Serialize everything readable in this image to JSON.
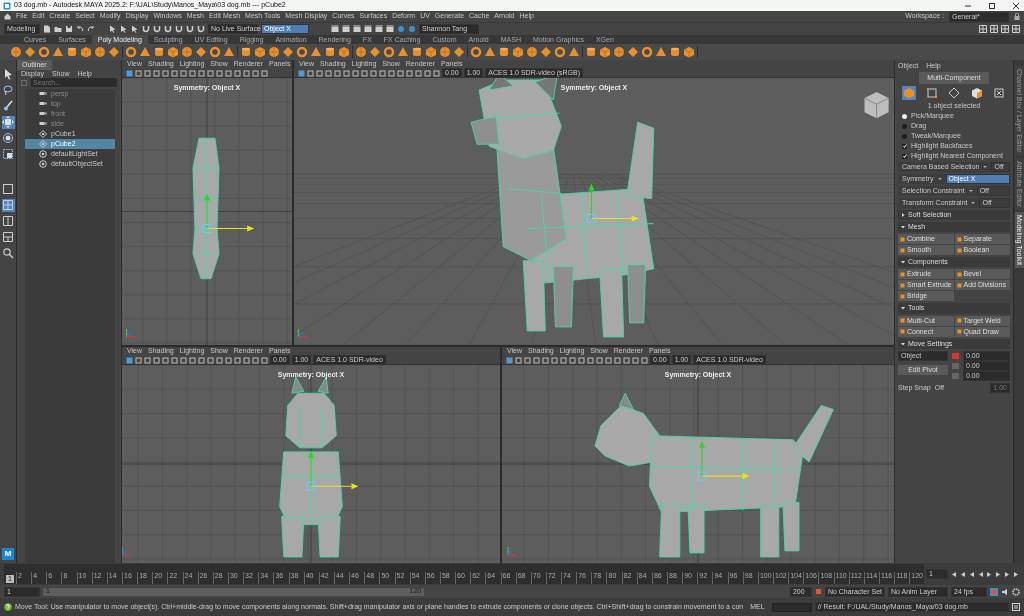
{
  "window": {
    "title": "03 dog.mb - Autodesk MAYA 2025.2: F:\\UAL\\Study\\Manos_Maya\\03 dog.mb  ---  pCube2"
  },
  "menu": [
    "File",
    "Edit",
    "Create",
    "Select",
    "Modify",
    "Display",
    "Windows",
    "Mesh",
    "Edit Mesh",
    "Mesh Tools",
    "Mesh Display",
    "Curves",
    "Surfaces",
    "Deform",
    "UV",
    "Generate",
    "Cache",
    "Arnold",
    "Help"
  ],
  "workspace": {
    "label": "Workspace :",
    "value": "General*"
  },
  "status_line": {
    "mode": "Modeling",
    "live_surface": "No Live Surface",
    "symmetry": "Object X",
    "user": "Shannon Tang"
  },
  "shelf_tabs": [
    {
      "label": "Curves",
      "selected": false
    },
    {
      "label": "Surfaces",
      "selected": false
    },
    {
      "label": "Poly Modeling",
      "selected": true
    },
    {
      "label": "Sculpting",
      "selected": false
    },
    {
      "label": "UV Editing",
      "selected": false
    },
    {
      "label": "Rigging",
      "selected": false
    },
    {
      "label": "Animation",
      "selected": false
    },
    {
      "label": "Rendering",
      "selected": false
    },
    {
      "label": "FX",
      "selected": false
    },
    {
      "label": "FX Caching",
      "selected": false
    },
    {
      "label": "Custom",
      "selected": false
    },
    {
      "label": "Arnold",
      "selected": false
    },
    {
      "label": "MASH",
      "selected": false
    },
    {
      "label": "Motion Graphics",
      "selected": false
    },
    {
      "label": "XGen",
      "selected": false
    }
  ],
  "outliner": {
    "title": "Outliner",
    "menu": [
      "Display",
      "Show",
      "Help"
    ],
    "search_placeholder": "Search...",
    "items": [
      {
        "label": "persp",
        "kind": "camera",
        "selected": false,
        "dimmed": true
      },
      {
        "label": "top",
        "kind": "camera",
        "selected": false,
        "dimmed": true
      },
      {
        "label": "front",
        "kind": "camera",
        "selected": false,
        "dimmed": true
      },
      {
        "label": "side",
        "kind": "camera",
        "selected": false,
        "dimmed": true
      },
      {
        "label": "pCube1",
        "kind": "mesh",
        "selected": false,
        "dimmed": false
      },
      {
        "label": "pCube2",
        "kind": "mesh",
        "selected": true,
        "dimmed": false
      },
      {
        "label": "defaultLightSet",
        "kind": "set",
        "selected": false,
        "dimmed": false
      },
      {
        "label": "defaultObjectSet",
        "kind": "set",
        "selected": false,
        "dimmed": false
      }
    ]
  },
  "viewports": [
    {
      "kind": "top",
      "menu": [
        "View",
        "Shading",
        "Lighting",
        "Show",
        "Renderer",
        "Panels"
      ],
      "symmetry": "Symmetry: Object X"
    },
    {
      "kind": "persp",
      "menu": [
        "View",
        "Shading",
        "Lighting",
        "Show",
        "Renderer",
        "Panels"
      ],
      "symmetry": "Symmetry: Object X",
      "exposure": "0.00",
      "gamma": "1.00",
      "color_space": "ACES 1.0 SDR-video (sRGB)"
    },
    {
      "kind": "front",
      "menu": [
        "View",
        "Shading",
        "Lighting",
        "Show",
        "Renderer",
        "Panels"
      ],
      "symmetry": "Symmetry: Object X",
      "exposure": "0.00",
      "gamma": "1.00",
      "color_space": "ACES 1.0 SDR-video"
    },
    {
      "kind": "side",
      "menu": [
        "View",
        "Shading",
        "Lighting",
        "Show",
        "Renderer",
        "Panels"
      ],
      "symmetry": "Symmetry: Object X",
      "exposure": "0.00",
      "gamma": "1.00",
      "color_space": "ACES 1.0 SDR-video"
    }
  ],
  "toolkit": {
    "menu": [
      "Object",
      "Help"
    ],
    "mode_button": "Multi-Component",
    "component_modes": [
      {
        "selected": true
      },
      {
        "selected": false
      },
      {
        "selected": false
      },
      {
        "selected": false
      },
      {
        "selected": false
      }
    ],
    "selection_info": "1 object selected",
    "pick_modes": [
      {
        "label": "Pick/Marquee",
        "selected": true
      },
      {
        "label": "Drag",
        "selected": false
      },
      {
        "label": "Tweak/Marquee",
        "selected": false
      }
    ],
    "options": [
      {
        "label": "Highlight Backfaces",
        "checked": true
      },
      {
        "label": "Highlight Nearest Component",
        "checked": true
      }
    ],
    "properties": [
      {
        "label": "Camera Based Selection",
        "value": "Off",
        "highlighted": false
      },
      {
        "label": "Symmetry",
        "value": "Object X",
        "highlighted": true
      },
      {
        "label": "Selection Constraint",
        "value": "Off",
        "highlighted": false
      },
      {
        "label": "Transform Constraint",
        "value": "Off",
        "highlighted": false
      }
    ],
    "sections": [
      {
        "title": "Soft Selection",
        "expanded": false
      },
      {
        "title": "Mesh",
        "expanded": true,
        "tools": [
          "Combine",
          "Separate",
          "Smooth",
          "Boolean"
        ]
      },
      {
        "title": "Components",
        "expanded": true,
        "tools": [
          "Extrude",
          "Bevel",
          "Smart Extrude",
          "Add Divisions",
          "Bridge"
        ]
      },
      {
        "title": "Tools",
        "expanded": true,
        "tools": [
          "Multi-Cut",
          "Target Weld",
          "Connect",
          "Quad Draw"
        ]
      }
    ],
    "move_settings": {
      "title": "Move Settings",
      "space": "Object",
      "pivot_button": "Edit Pivot",
      "values": [
        "0.00",
        "0.00",
        "0.00"
      ],
      "step_snap_label": "Step Snap",
      "step_snap": "Off",
      "step_value": "1.00"
    }
  },
  "side_tabs": [
    {
      "label": "Channel Box / Layer Editor",
      "selected": false
    },
    {
      "label": "Attribute Editor",
      "selected": false
    },
    {
      "label": "Modeling Toolkit",
      "selected": true
    }
  ],
  "logo": "M",
  "timeline": {
    "ticks": [
      "2",
      "4",
      "6",
      "8",
      "10",
      "12",
      "14",
      "16",
      "18",
      "20",
      "22",
      "24",
      "26",
      "28",
      "30",
      "32",
      "34",
      "36",
      "38",
      "40",
      "42",
      "44",
      "46",
      "48",
      "50",
      "52",
      "54",
      "56",
      "58",
      "60",
      "62",
      "64",
      "66",
      "68",
      "70",
      "72",
      "74",
      "76",
      "78",
      "80",
      "82",
      "84",
      "86",
      "88",
      "90",
      "92",
      "94",
      "96",
      "98",
      "100",
      "102",
      "104",
      "106",
      "108",
      "110",
      "112",
      "114",
      "116",
      "118",
      "120"
    ],
    "current": "1",
    "current_field": "1"
  },
  "range": {
    "start": "1",
    "slider_start": "1",
    "slider_end": "120",
    "end": "200",
    "character_set": "No Character Set",
    "anim_layer": "No Anim Layer",
    "fps": "24 fps"
  },
  "command_line": {
    "help": "Move Tool: Use manipulator to move object(s). Ctrl+middle-drag to move components along normals. Shift+drag manipulator axis or plane handles to extrude components or clone objects. Ctrl+Shift+drag to constrain movement to a con",
    "language": "MEL",
    "result": "// Result: F:/UAL/Study/Manos_Maya/03 dog.mb"
  }
}
